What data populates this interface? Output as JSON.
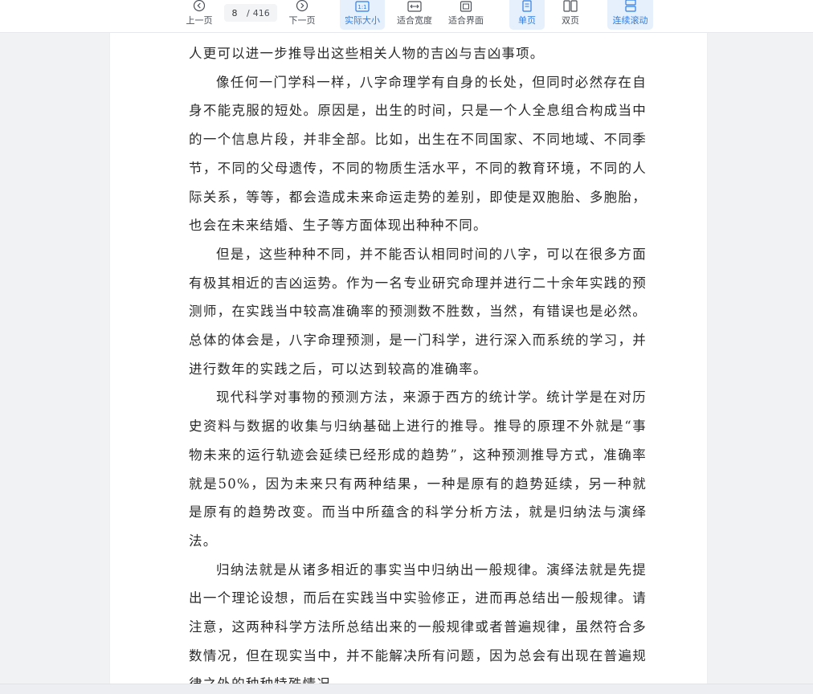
{
  "toolbar": {
    "prev_label": "上一页",
    "next_label": "下一页",
    "current_page": "8",
    "page_separator": "/",
    "total_pages": "416",
    "actual_size_label": "实际大小",
    "fit_width_label": "适合宽度",
    "fit_page_label": "适合界面",
    "single_page_label": "单页",
    "double_page_label": "双页",
    "continuous_scroll_label": "连续滚动"
  },
  "colors": {
    "accent": "#2e7de3",
    "active_bg": "#e6f0fc"
  },
  "document": {
    "paragraphs": [
      {
        "text": "人更可以进一步推导出这些相关人物的吉凶与吉凶事项。",
        "indent": false
      },
      {
        "text": "像任何一门学科一样，八字命理学有自身的长处，但同时必然存在自身不能克服的短处。原因是，出生的时间，只是一个人全息组合构成当中的一个信息片段，并非全部。比如，出生在不同国家、不同地域、不同季节，不同的父母遗传，不同的物质生活水平，不同的教育环境，不同的人际关系，等等，都会造成未来命运走势的差别，即使是双胞胎、多胞胎，也会在未来结婚、生子等方面体现出种种不同。",
        "indent": true
      },
      {
        "text": "但是，这些种种不同，并不能否认相同时间的八字，可以在很多方面有极其相近的吉凶运势。作为一名专业研究命理并进行二十余年实践的预测师，在实践当中较高准确率的预测数不胜数，当然，有错误也是必然。总体的体会是，八字命理预测，是一门科学，进行深入而系统的学习，并进行数年的实践之后，可以达到较高的准确率。",
        "indent": true
      },
      {
        "text": "现代科学对事物的预测方法，来源于西方的统计学。统计学是在对历史资料与数据的收集与归纳基础上进行的推导。推导的原理不外就是“事物未来的运行轨迹会延续已经形成的趋势”，这种预测推导方式，准确率就是50%，因为未来只有两种结果，一种是原有的趋势延续，另一种就是原有的趋势改变。而当中所蕴含的科学分析方法，就是归纳法与演绎法。",
        "indent": true
      },
      {
        "text": "归纳法就是从诸多相近的事实当中归纳出一般规律。演绎法就是先提出一个理论设想，而后在实践当中实验修正，进而再总结出一般规律。请注意，这两种科学方法所总结出来的一般规律或者普遍规律，虽然符合多数情况，但在现实当中，并不能解决所有问题，因为总会有出现在普遍规律之外的种种特殊情况。",
        "indent": true
      }
    ]
  }
}
